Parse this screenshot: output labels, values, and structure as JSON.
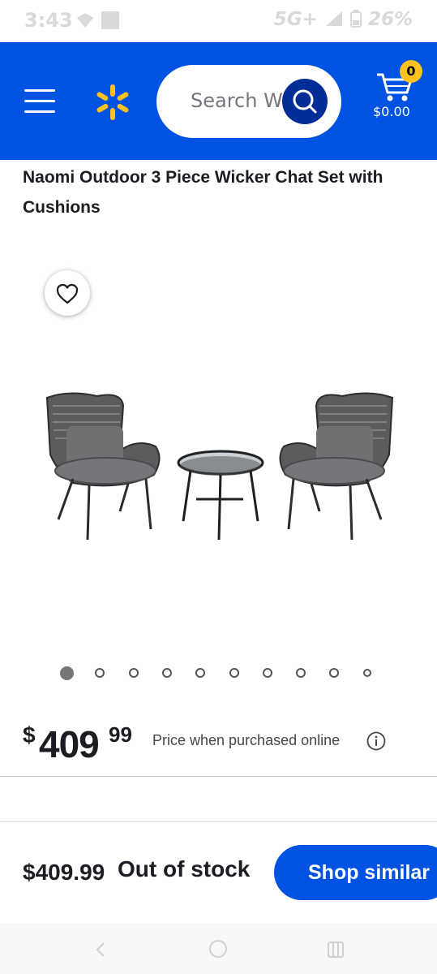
{
  "status_bar": {
    "time": "3:43",
    "network": "5G+",
    "battery": "26%"
  },
  "header": {
    "brand_icon": "walmart-spark-icon",
    "search_placeholder": "Search Walmart",
    "search_visible_text": "Search Wa",
    "cart": {
      "count": "0",
      "total": "$0.00"
    },
    "colors": {
      "header_bg": "#0053e2",
      "spark": "#ffc220",
      "badge": "#ffc220",
      "search_button": "#002d96"
    }
  },
  "product": {
    "title": "Naomi Outdoor 3 Piece Wicker Chat Set with Cushions",
    "image_count": 10,
    "active_image": 1,
    "price": {
      "currency": "$",
      "dollars": "409",
      "cents": "99",
      "note": "Price when purchased online"
    }
  },
  "bottom_bar": {
    "price": "$409.99",
    "stock_status": "Out of stock",
    "button_label": "Shop similar"
  },
  "icons": [
    "menu-icon",
    "walmart-spark-icon",
    "search-icon",
    "cart-icon",
    "heart-icon",
    "info-icon",
    "back-icon",
    "home-icon",
    "recents-icon"
  ]
}
